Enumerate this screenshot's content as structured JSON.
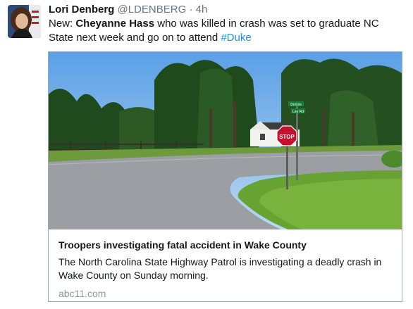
{
  "tweet": {
    "author_name": "Lori Denberg",
    "author_handle": "@LDENBERG",
    "separator": "·",
    "time": "4h",
    "text_prefix": "New: ",
    "text_bold": "Cheyanne Hass",
    "text_mid": " who was killed in crash was set to graduate NC State next week and go on to attend ",
    "hashtag": "#Duke"
  },
  "card": {
    "title": "Troopers investigating fatal accident in Wake County",
    "description": "The North Carolina State Highway Patrol is investigating a deadly crash in Wake County on Sunday morning.",
    "domain": "abc11.com",
    "image": {
      "stop_sign_text": "STOP",
      "street_sign_top": "Dennis",
      "street_sign_bottom": "Lee Rd"
    }
  },
  "colors": {
    "name": "#14171a",
    "meta": "#657786",
    "hashtag": "#1b95e0",
    "card_border": "#a0aab4",
    "domain": "#8899a6"
  }
}
